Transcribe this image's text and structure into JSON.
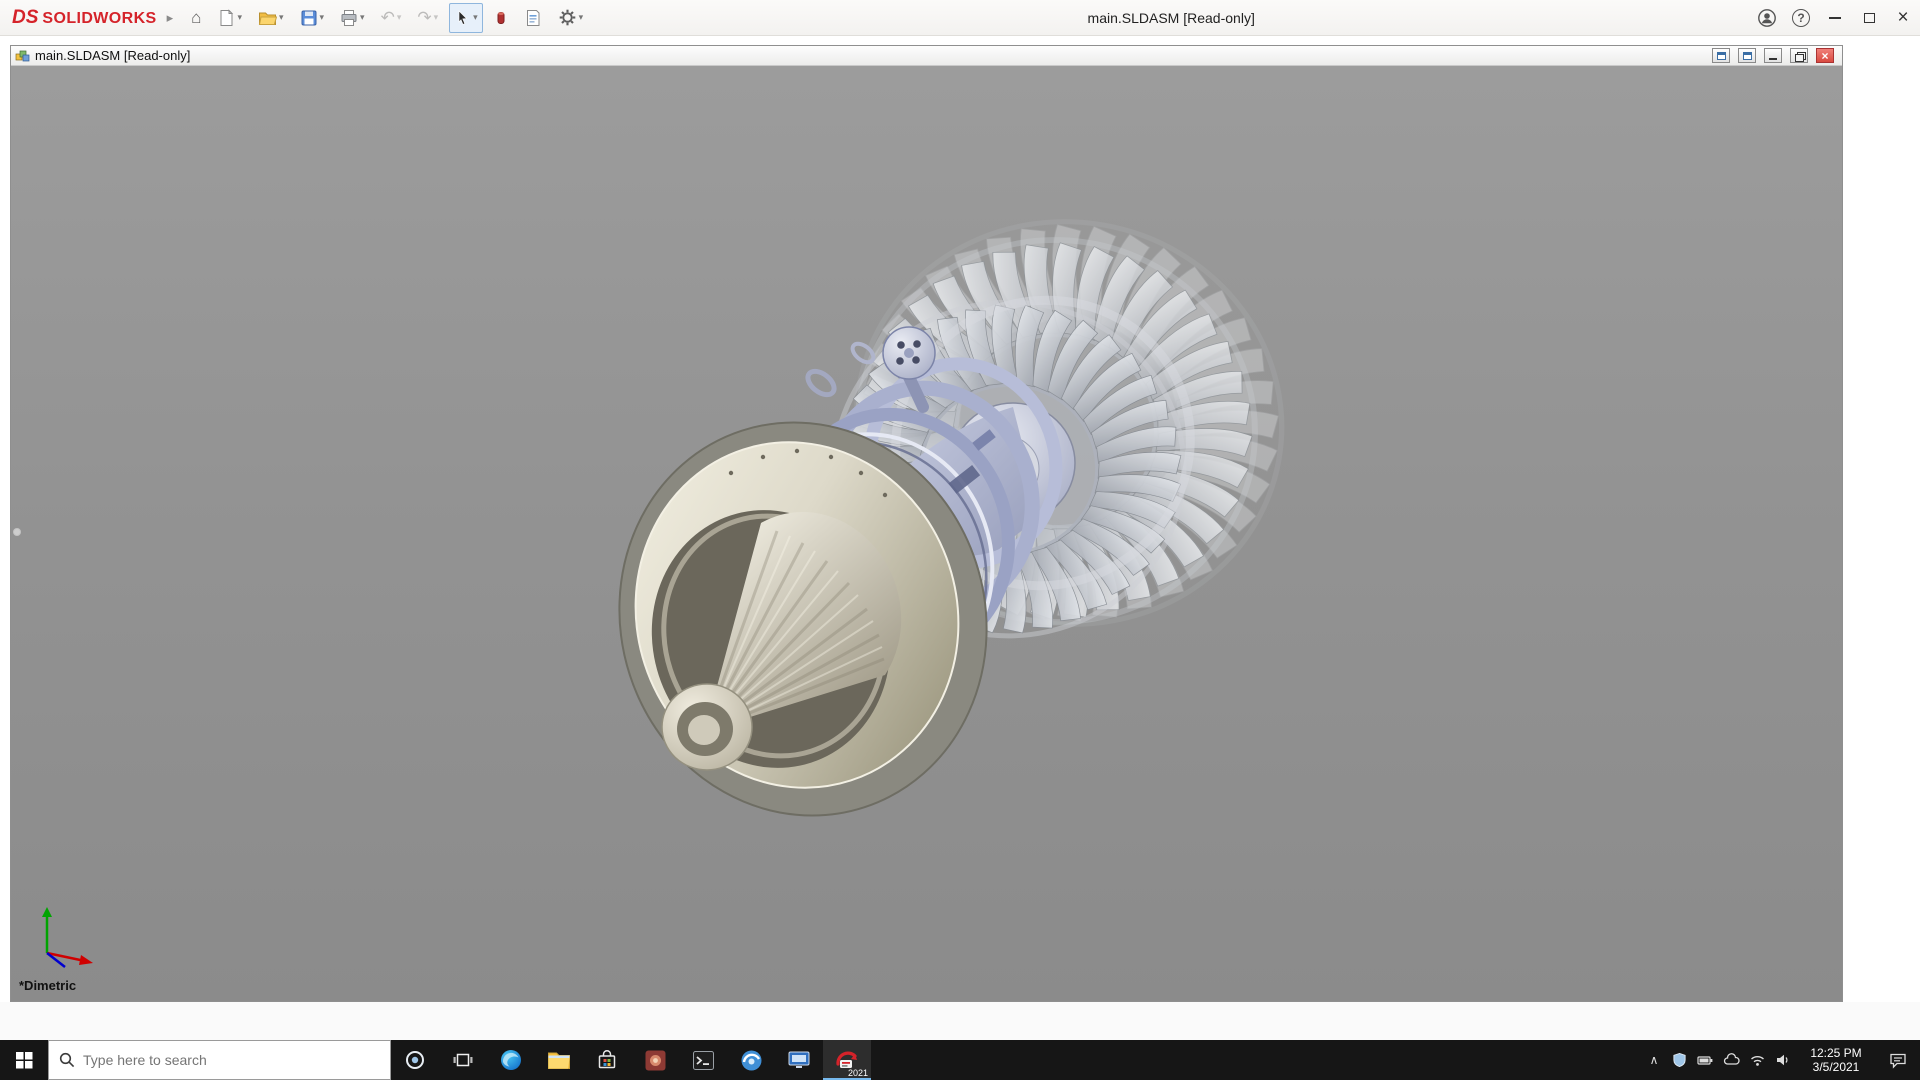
{
  "titlebar": {
    "logo_mark": "DS",
    "logo_text": "SOLIDWORKS",
    "title": "main.SLDASM [Read-only]"
  },
  "glyphs": {
    "expander": "▸",
    "dropdown": "▾",
    "home": "⌂",
    "undo": "↶",
    "redo": "↷",
    "help": "?",
    "close": "×",
    "tray_chevron": "∧"
  },
  "document_window": {
    "title": "main.SLDASM [Read-only]"
  },
  "viewport": {
    "view_orientation": "*Dimetric"
  },
  "taskbar": {
    "search_placeholder": "Type here to search",
    "solidworks_year": "2021",
    "clock_time": "12:25 PM",
    "clock_date": "3/5/2021"
  }
}
